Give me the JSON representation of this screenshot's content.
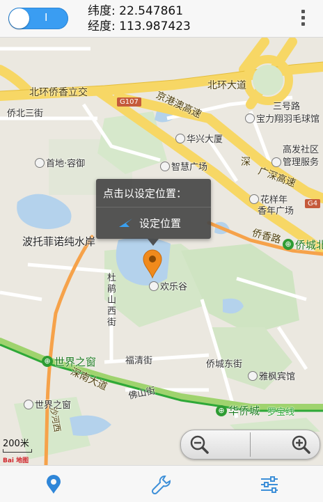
{
  "header": {
    "toggle_state": "I",
    "latitude_label": "纬度: 22.547861",
    "longitude_label": "经度: 113.987423",
    "menu_icon": "overflow-menu-icon"
  },
  "map": {
    "labels": {
      "beihuan_road": "北环大道",
      "beihuan_qiaoxiang": "北环侨香立交",
      "qiaobei_3": "侨北三街",
      "jinggang_ao": "京港澳高速",
      "g107": "G107",
      "sanhaolu": "三号路",
      "baoli": "宝力翔羽毛球馆",
      "huaxing": "华兴大厦",
      "gaofa": "高发社区",
      "guanli": "管理服务",
      "shoudi": "首地·容御",
      "zhihui": "智慧广场",
      "guangshen": "广深高速",
      "shen_road": "深",
      "huayang": "花样年",
      "xiangnian": "香年广场",
      "g4": "G4",
      "qiaoxiang": "侨香路",
      "qiaocheng_north": "侨城北",
      "botofei": "波托菲诺纯水岸",
      "dupeng1": "杜",
      "dupeng2": "鹃",
      "dupeng3": "山",
      "dupeng4": "西",
      "dupeng5": "街",
      "huanlegu": "欢乐谷",
      "shijiezhichuang_metro": "世界之窗",
      "shennan": "深南大道",
      "fuqing": "福清街",
      "qiaocheng_east": "侨城东街",
      "foshan": "佛山街",
      "yafeng": "雅枫宾馆",
      "shijiezhichuang": "世界之窗",
      "huaqiaocheng": "华侨城",
      "luobao": "罗宝线",
      "shahe": "沙河西"
    }
  },
  "popup": {
    "title": "点击以设定位置：",
    "action": "设定位置"
  },
  "map_overlay": {
    "scale": "200米",
    "logo": "Bai 地图",
    "zoom_out_icon": "zoom-out-icon",
    "zoom_in_icon": "zoom-in-icon"
  },
  "bottom_nav": {
    "tabs": [
      "location-pin-icon",
      "wrench-icon",
      "sliders-icon"
    ]
  }
}
